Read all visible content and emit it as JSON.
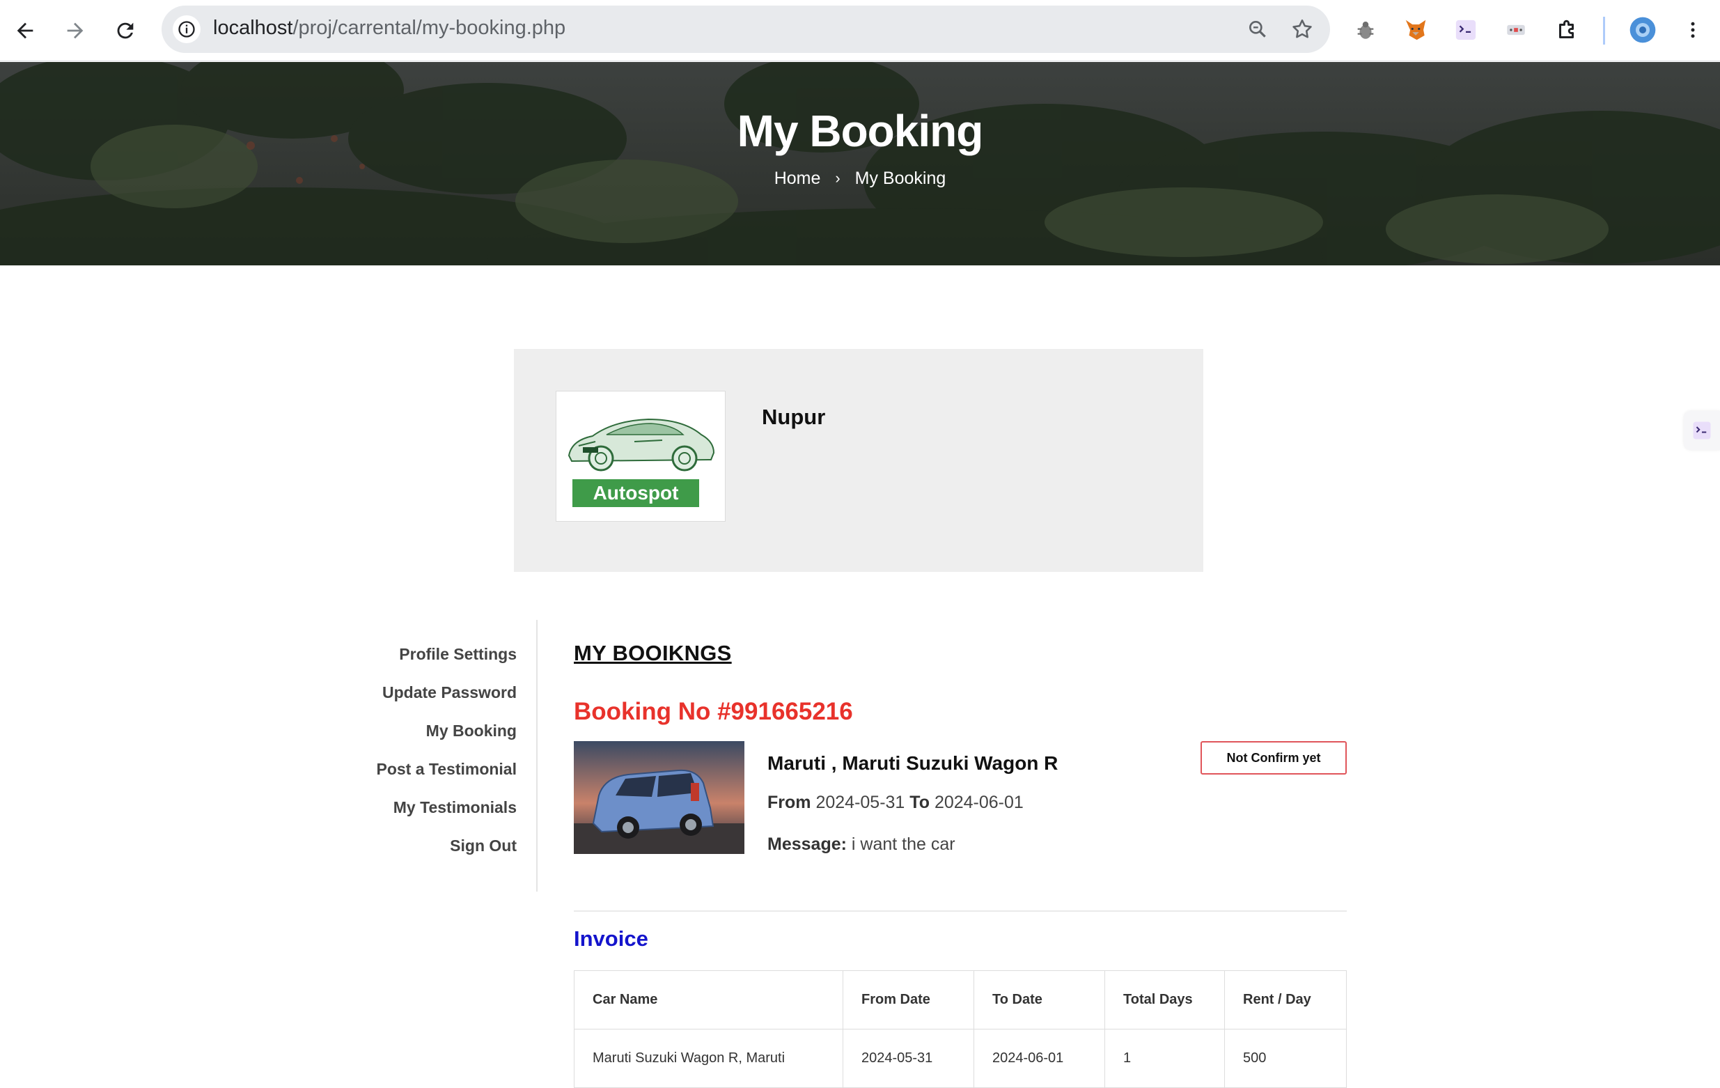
{
  "browser": {
    "url_host": "localhost",
    "url_path": "/proj/carrental/my-booking.php",
    "icons": [
      "back-arrow-icon",
      "forward-arrow-icon",
      "reload-icon",
      "info-icon",
      "zoom-icon",
      "star-icon",
      "bug-extension-icon",
      "fox-extension-icon",
      "code-extension-icon",
      "tag-extension-icon",
      "puzzle-icon",
      "profile-icon",
      "kebab-menu-icon"
    ]
  },
  "hero": {
    "title": "My Booking",
    "breadcrumb": {
      "home": "Home",
      "separator": "›",
      "current": "My Booking"
    }
  },
  "profile": {
    "logo_text": "Autospot",
    "name": "Nupur",
    "logo_band_color": "#3f9b49"
  },
  "sidebar": {
    "items": [
      {
        "label": "Profile Settings"
      },
      {
        "label": "Update Password"
      },
      {
        "label": "My Booking"
      },
      {
        "label": "Post a Testimonial"
      },
      {
        "label": "My Testimonials"
      },
      {
        "label": "Sign Out"
      }
    ]
  },
  "main": {
    "heading": "MY BOOIKNGS",
    "booking": {
      "number": "Booking No #991665216",
      "car_title": "Maruti , Maruti Suzuki Wagon R",
      "from_label": "From",
      "from_date": "2024-05-31",
      "to_label": "To",
      "to_date": "2024-06-01",
      "message_label": "Message:",
      "message_text": "i want the car",
      "status": "Not Confirm yet"
    },
    "invoice": {
      "title": "Invoice",
      "columns": [
        "Car Name",
        "From Date",
        "To Date",
        "Total Days",
        "Rent / Day"
      ],
      "rows": [
        [
          "Maruti Suzuki Wagon R, Maruti",
          "2024-05-31",
          "2024-06-01",
          "1",
          "500"
        ]
      ]
    }
  },
  "colors": {
    "booking_no": "#e8322b",
    "invoice_title": "#1414cc",
    "status_border": "#e0555a"
  }
}
